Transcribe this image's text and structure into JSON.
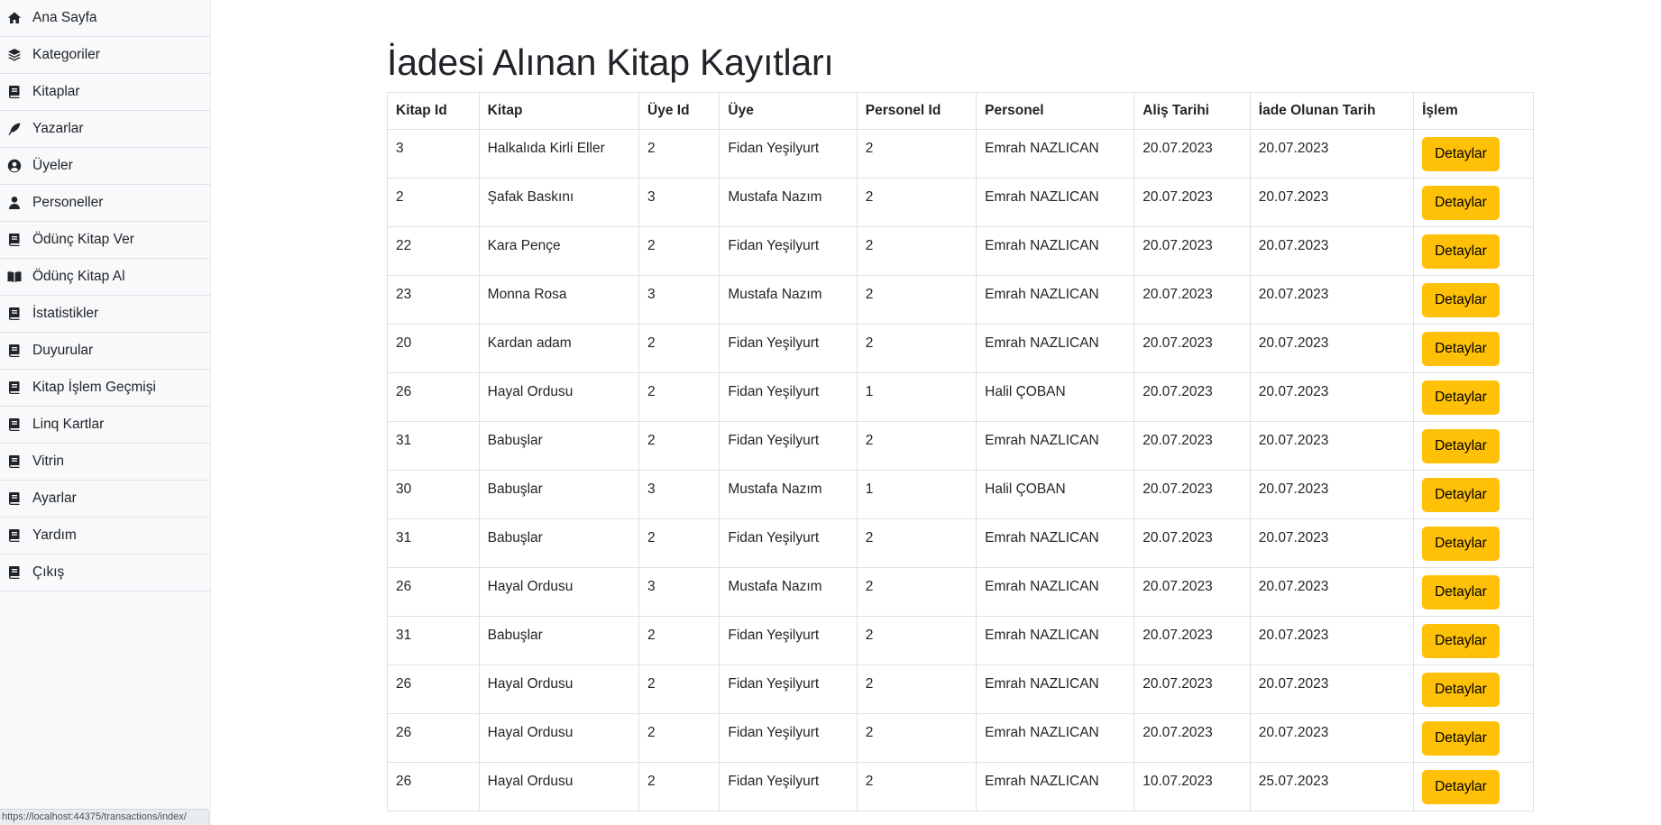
{
  "sidebar": {
    "items": [
      {
        "label": "Ana Sayfa",
        "icon": "home-icon"
      },
      {
        "label": "Kategoriler",
        "icon": "layers-icon"
      },
      {
        "label": "Kitaplar",
        "icon": "book-icon"
      },
      {
        "label": "Yazarlar",
        "icon": "feather-icon"
      },
      {
        "label": "Üyeler",
        "icon": "user-circle-icon"
      },
      {
        "label": "Personeller",
        "icon": "user-icon"
      },
      {
        "label": "Ödünç Kitap Ver",
        "icon": "book-icon"
      },
      {
        "label": "Ödünç Kitap Al",
        "icon": "book-open-icon"
      },
      {
        "label": "İstatistikler",
        "icon": "book-icon"
      },
      {
        "label": "Duyurular",
        "icon": "book-icon"
      },
      {
        "label": "Kitap İşlem Geçmişi",
        "icon": "book-icon"
      },
      {
        "label": "Linq Kartlar",
        "icon": "book-icon"
      },
      {
        "label": "Vitrin",
        "icon": "book-icon"
      },
      {
        "label": "Ayarlar",
        "icon": "book-icon"
      },
      {
        "label": "Yardım",
        "icon": "book-icon"
      },
      {
        "label": "Çıkış",
        "icon": "book-icon"
      }
    ]
  },
  "status_url": "https://localhost:44375/transactions/index/",
  "page_title": "İadesi Alınan Kitap Kayıtları",
  "table": {
    "headers": [
      "Kitap Id",
      "Kitap",
      "Üye Id",
      "Üye",
      "Personel Id",
      "Personel",
      "Aliş Tarihi",
      "İade Olunan Tarih",
      "İşlem"
    ],
    "action_label": "Detaylar",
    "rows": [
      [
        "3",
        "Halkalıda Kirli Eller",
        "2",
        "Fidan Yeşilyurt",
        "2",
        "Emrah NAZLICAN",
        "20.07.2023",
        "20.07.2023"
      ],
      [
        "2",
        "Şafak Baskını",
        "3",
        "Mustafa Nazım",
        "2",
        "Emrah NAZLICAN",
        "20.07.2023",
        "20.07.2023"
      ],
      [
        "22",
        "Kara Pençe",
        "2",
        "Fidan Yeşilyurt",
        "2",
        "Emrah NAZLICAN",
        "20.07.2023",
        "20.07.2023"
      ],
      [
        "23",
        "Monna Rosa",
        "3",
        "Mustafa Nazım",
        "2",
        "Emrah NAZLICAN",
        "20.07.2023",
        "20.07.2023"
      ],
      [
        "20",
        "Kardan adam",
        "2",
        "Fidan Yeşilyurt",
        "2",
        "Emrah NAZLICAN",
        "20.07.2023",
        "20.07.2023"
      ],
      [
        "26",
        "Hayal Ordusu",
        "2",
        "Fidan Yeşilyurt",
        "1",
        "Halil ÇOBAN",
        "20.07.2023",
        "20.07.2023"
      ],
      [
        "31",
        "Babuşlar",
        "2",
        "Fidan Yeşilyurt",
        "2",
        "Emrah NAZLICAN",
        "20.07.2023",
        "20.07.2023"
      ],
      [
        "30",
        "Babuşlar",
        "3",
        "Mustafa Nazım",
        "1",
        "Halil ÇOBAN",
        "20.07.2023",
        "20.07.2023"
      ],
      [
        "31",
        "Babuşlar",
        "2",
        "Fidan Yeşilyurt",
        "2",
        "Emrah NAZLICAN",
        "20.07.2023",
        "20.07.2023"
      ],
      [
        "26",
        "Hayal Ordusu",
        "3",
        "Mustafa Nazım",
        "2",
        "Emrah NAZLICAN",
        "20.07.2023",
        "20.07.2023"
      ],
      [
        "31",
        "Babuşlar",
        "2",
        "Fidan Yeşilyurt",
        "2",
        "Emrah NAZLICAN",
        "20.07.2023",
        "20.07.2023"
      ],
      [
        "26",
        "Hayal Ordusu",
        "2",
        "Fidan Yeşilyurt",
        "2",
        "Emrah NAZLICAN",
        "20.07.2023",
        "20.07.2023"
      ],
      [
        "26",
        "Hayal Ordusu",
        "2",
        "Fidan Yeşilyurt",
        "2",
        "Emrah NAZLICAN",
        "20.07.2023",
        "20.07.2023"
      ],
      [
        "26",
        "Hayal Ordusu",
        "2",
        "Fidan Yeşilyurt",
        "2",
        "Emrah NAZLICAN",
        "10.07.2023",
        "25.07.2023"
      ]
    ]
  },
  "colors": {
    "action_button": "#ffc107",
    "sidebar_bg": "#f8f9fa"
  }
}
